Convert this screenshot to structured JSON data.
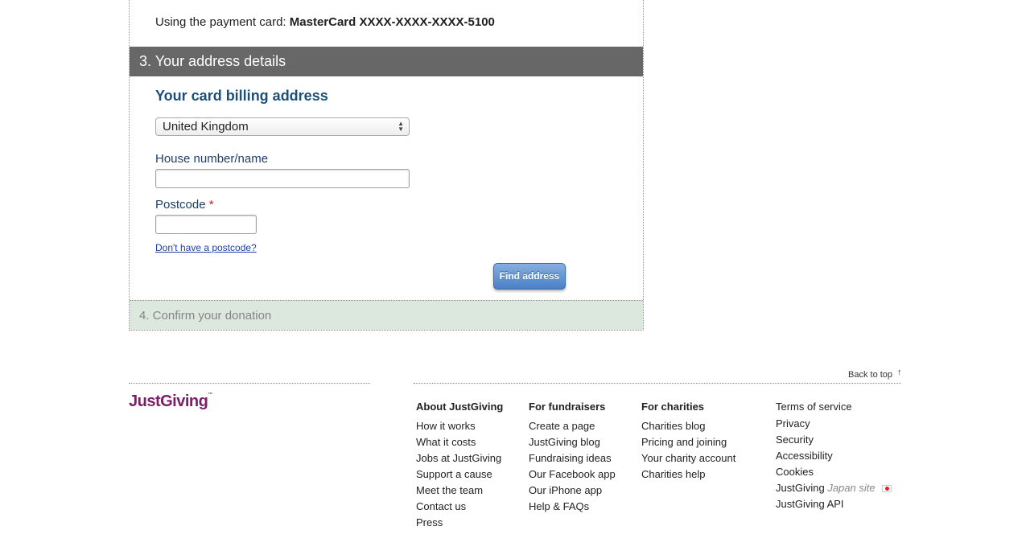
{
  "payment": {
    "prefix": "Using the payment card: ",
    "card": "MasterCard XXXX-XXXX-XXXX-5100"
  },
  "step3": {
    "title": "3. Your address details"
  },
  "billing": {
    "title": "Your card billing address",
    "country_selected": "United Kingdom",
    "house_label": "House number/name",
    "house_value": "",
    "postcode_label": "Postcode",
    "required_mark": "*",
    "postcode_value": "",
    "no_postcode_link": "Don't have a postcode?",
    "find_button": "Find address"
  },
  "step4": {
    "title": "4. Confirm your donation"
  },
  "footer": {
    "back_to_top": "Back to top",
    "back_arrow": "↑",
    "logo": "JustGiving",
    "logo_tm": "™",
    "about": {
      "heading": "About JustGiving",
      "items": [
        "How it works",
        "What it costs",
        "Jobs at JustGiving",
        "Support a cause",
        "Meet the team",
        "Contact us",
        "Press"
      ]
    },
    "fundraisers": {
      "heading": "For fundraisers",
      "items": [
        "Create a page",
        "JustGiving blog",
        "Fundraising ideas",
        "Our Facebook app",
        "Our iPhone app",
        "Help & FAQs"
      ]
    },
    "charities": {
      "heading": "For charities",
      "items": [
        "Charities blog",
        "Pricing and joining",
        "Your charity account",
        "Charities help"
      ]
    },
    "legal": {
      "items": [
        "Terms of service",
        "Privacy",
        "Security",
        "Accessibility",
        "Cookies"
      ],
      "japan_main": "JustGiving ",
      "japan_muted": "Japan site",
      "api": "JustGiving API"
    }
  },
  "colors": {
    "heading_blue": "#1d4f7a",
    "step_bar": "#676767",
    "step4_bg": "#dce8de",
    "logo_purple": "#7a1f66",
    "button_blue": "#4b7fc5"
  }
}
